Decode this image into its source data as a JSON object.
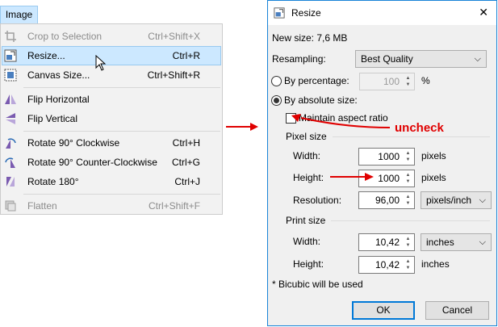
{
  "menu": {
    "tab_label": "Image",
    "items": [
      {
        "label": "Crop to Selection",
        "shortcut": "Ctrl+Shift+X",
        "icon": "crop-icon"
      },
      {
        "label": "Resize...",
        "shortcut": "Ctrl+R",
        "icon": "resize-icon"
      },
      {
        "label": "Canvas Size...",
        "shortcut": "Ctrl+Shift+R",
        "icon": "canvas-size-icon"
      },
      {
        "label": "Flip Horizontal",
        "shortcut": "",
        "icon": "flip-horizontal-icon"
      },
      {
        "label": "Flip Vertical",
        "shortcut": "",
        "icon": "flip-vertical-icon"
      },
      {
        "label": "Rotate 90° Clockwise",
        "shortcut": "Ctrl+H",
        "icon": "rotate-cw-icon"
      },
      {
        "label": "Rotate 90° Counter-Clockwise",
        "shortcut": "Ctrl+G",
        "icon": "rotate-ccw-icon"
      },
      {
        "label": "Rotate 180°",
        "shortcut": "Ctrl+J",
        "icon": "rotate-180-icon"
      },
      {
        "label": "Flatten",
        "shortcut": "Ctrl+Shift+F",
        "icon": "flatten-icon"
      }
    ]
  },
  "dialog": {
    "title": "Resize",
    "close_glyph": "✕",
    "new_size": "New size: 7,6 MB",
    "resampling_label": "Resampling:",
    "resampling_value": "Best Quality",
    "by_percentage_label": "By percentage:",
    "percentage_value": "100",
    "percent_sign": "%",
    "by_absolute_label": "By absolute size:",
    "maintain_aspect_label": "Maintain aspect ratio",
    "pixel_size_header": "Pixel size",
    "width_label": "Width:",
    "width_value": "1000",
    "height_label": "Height:",
    "height_value": "1000",
    "pixels_unit": "pixels",
    "resolution_label": "Resolution:",
    "resolution_value": "96,00",
    "resolution_unit": "pixels/inch",
    "print_size_header": "Print size",
    "print_width_label": "Width:",
    "print_width_value": "10,42",
    "print_width_unit": "inches",
    "print_height_label": "Height:",
    "print_height_value": "10,42",
    "print_height_unit": "inches",
    "note": "* Bicubic will be used",
    "ok_label": "OK",
    "cancel_label": "Cancel"
  },
  "annotation": {
    "uncheck_label": "uncheck",
    "color": "#e00000"
  }
}
